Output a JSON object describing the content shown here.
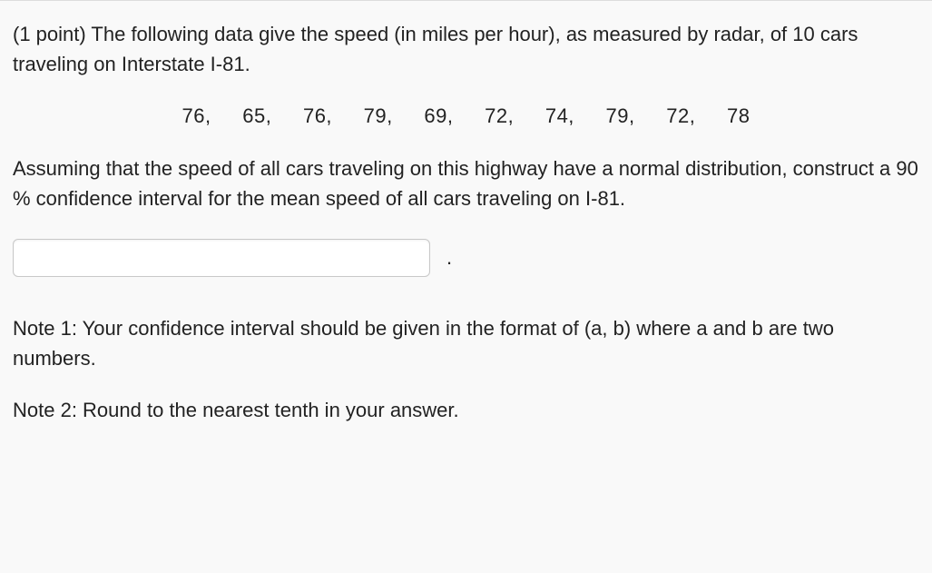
{
  "question": {
    "intro": "(1 point) The following data give the speed (in miles per hour), as measured by radar, of 10 cars traveling on Interstate I-81.",
    "data_values": [
      "76,",
      "65,",
      "76,",
      "79,",
      "69,",
      "72,",
      "74,",
      "79,",
      "72,",
      "78"
    ],
    "instruction": "Assuming that the speed of all cars traveling on this highway have a normal distribution, construct a 90 % confidence interval for the mean speed of all cars traveling on I-81.",
    "period": ".",
    "note1": "Note 1: Your confidence interval should be given in the format of (a, b) where a and b are two numbers.",
    "note2": "Note 2: Round to the nearest tenth in your answer."
  },
  "input": {
    "value": ""
  }
}
